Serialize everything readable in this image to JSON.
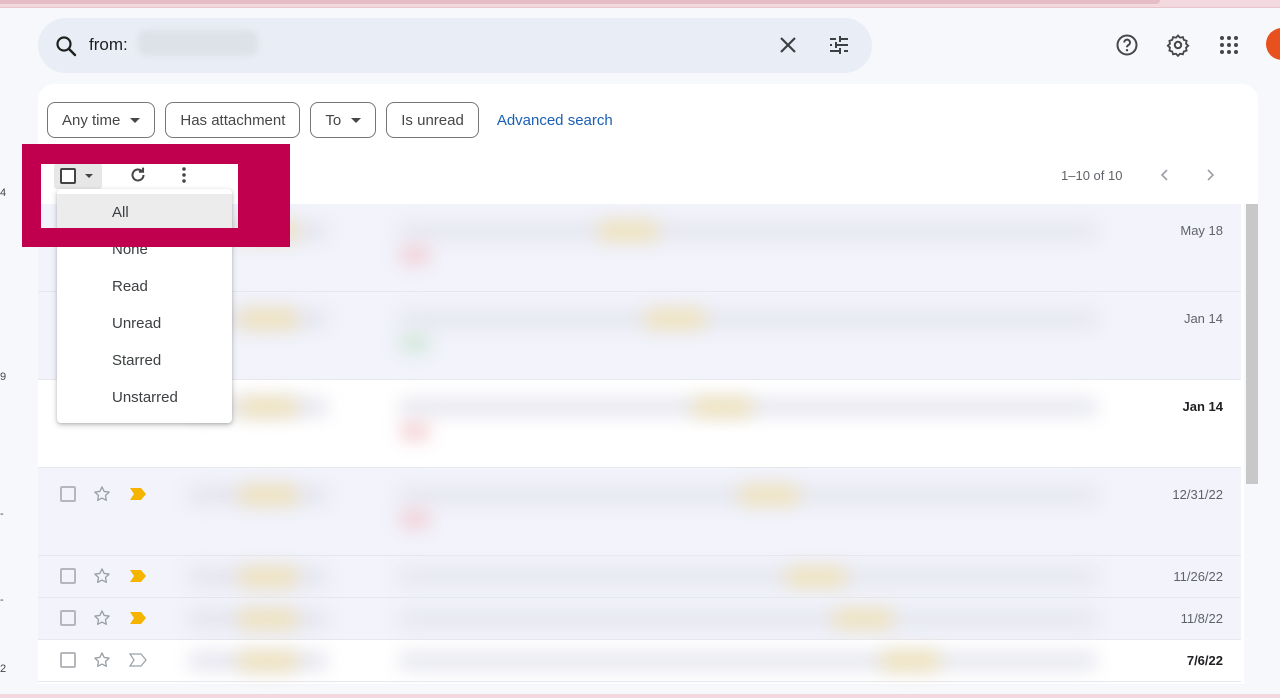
{
  "search": {
    "query": "from:",
    "query_value_redacted": true
  },
  "header_icons": [
    "help-icon",
    "settings-icon",
    "apps-icon",
    "account-avatar"
  ],
  "sidebar_fragments": [
    "4",
    "9",
    "-",
    "-",
    "2"
  ],
  "filter_chips": [
    {
      "label": "Any time",
      "has_dropdown": true
    },
    {
      "label": "Has attachment",
      "has_dropdown": false
    },
    {
      "label": "To",
      "has_dropdown": true
    },
    {
      "label": "Is unread",
      "has_dropdown": false
    }
  ],
  "advanced_search_label": "Advanced search",
  "toolbar": {
    "select_icon": "checkbox-icon",
    "refresh_icon": "refresh-icon",
    "more_icon": "more-vert-icon"
  },
  "pager": {
    "range_text": "1–10 of 10",
    "prev_icon": "chevron-left-icon",
    "next_icon": "chevron-right-icon"
  },
  "select_menu": {
    "items": [
      "All",
      "None",
      "Read",
      "Unread",
      "Starred",
      "Unstarred"
    ],
    "hovered": "All"
  },
  "mail_rows": [
    {
      "date": "May 18",
      "unread": false,
      "important": true,
      "content_blurred": true
    },
    {
      "date": "Jan 14",
      "unread": false,
      "important": true,
      "content_blurred": true
    },
    {
      "date": "Jan 14",
      "unread": true,
      "important": true,
      "content_blurred": true
    },
    {
      "date": "12/31/22",
      "unread": false,
      "important": true,
      "content_blurred": true
    },
    {
      "date": "11/26/22",
      "unread": false,
      "important": true,
      "content_blurred": true
    },
    {
      "date": "11/8/22",
      "unread": false,
      "important": true,
      "content_blurred": true
    },
    {
      "date": "7/6/22",
      "unread": true,
      "important": false,
      "content_blurred": true
    }
  ],
  "colors": {
    "highlight_box": "#c0004e",
    "important_marker": "#f4b400",
    "avatar": "#e8501e",
    "link": "#1a5fb4"
  }
}
